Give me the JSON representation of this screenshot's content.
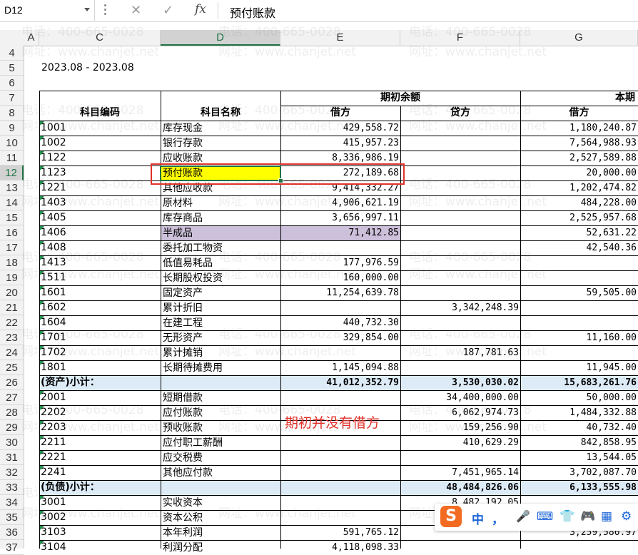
{
  "formula_bar": {
    "name_box": "D12",
    "formula": "预付账款",
    "fx_label": "fx",
    "cancel_glyph": "✕",
    "confirm_glyph": "✓"
  },
  "columns": [
    "A",
    "C",
    "D",
    "E",
    "F",
    "G"
  ],
  "selected_column": "D",
  "rows": [
    "4",
    "5",
    "6",
    "7",
    "8",
    "9",
    "10",
    "11",
    "12",
    "13",
    "14",
    "15",
    "16",
    "17",
    "18",
    "19",
    "20",
    "21",
    "22",
    "23",
    "24",
    "25",
    "26",
    "27",
    "28",
    "29",
    "30",
    "31",
    "32",
    "33",
    "34",
    "35",
    "36",
    "37"
  ],
  "selected_row": "12",
  "sheet": {
    "period": "2023.08 - 2023.08",
    "header_group_opening": "期初余额",
    "header_group_current": "本期",
    "header_code": "科目编码",
    "header_name": "科目名称",
    "header_debit": "借方",
    "header_credit": "贷方",
    "header_debit2": "借方",
    "data_rows": [
      {
        "code": "1001",
        "name": "库存现金",
        "debit": "429,558.72",
        "credit": "",
        "cur_debit": "1,180,240.87"
      },
      {
        "code": "1002",
        "name": "银行存款",
        "debit": "415,957.23",
        "credit": "",
        "cur_debit": "7,564,988.93"
      },
      {
        "code": "1122",
        "name": "应收账款",
        "debit": "8,336,986.19",
        "credit": "",
        "cur_debit": "2,527,589.88"
      },
      {
        "code": "1123",
        "name": "预付账款",
        "debit": "272,189.68",
        "credit": "",
        "cur_debit": "20,000.00"
      },
      {
        "code": "1221",
        "name": "其他应收款",
        "debit": "9,414,332.27",
        "credit": "",
        "cur_debit": "1,202,474.82"
      },
      {
        "code": "1403",
        "name": "原材料",
        "debit": "4,906,621.19",
        "credit": "",
        "cur_debit": "484,228.00"
      },
      {
        "code": "1405",
        "name": "库存商品",
        "debit": "3,656,997.11",
        "credit": "",
        "cur_debit": "2,525,957.68"
      },
      {
        "code": "1406",
        "name": "半成品",
        "debit": "71,412.85",
        "credit": "",
        "cur_debit": "52,631.22"
      },
      {
        "code": "1408",
        "name": "委托加工物资",
        "debit": "",
        "credit": "",
        "cur_debit": "42,540.36"
      },
      {
        "code": "1413",
        "name": "低值易耗品",
        "debit": "177,976.59",
        "credit": "",
        "cur_debit": ""
      },
      {
        "code": "1511",
        "name": "长期股权投资",
        "debit": "160,000.00",
        "credit": "",
        "cur_debit": ""
      },
      {
        "code": "1601",
        "name": "固定资产",
        "debit": "11,254,639.78",
        "credit": "",
        "cur_debit": "59,505.00"
      },
      {
        "code": "1602",
        "name": "累计折旧",
        "debit": "",
        "credit": "3,342,248.39",
        "cur_debit": ""
      },
      {
        "code": "1604",
        "name": "在建工程",
        "debit": "440,732.30",
        "credit": "",
        "cur_debit": ""
      },
      {
        "code": "1701",
        "name": "无形资产",
        "debit": "329,854.00",
        "credit": "",
        "cur_debit": "11,160.00"
      },
      {
        "code": "1702",
        "name": "累计摊销",
        "debit": "",
        "credit": "187,781.63",
        "cur_debit": ""
      },
      {
        "code": "1801",
        "name": "长期待摊费用",
        "debit": "1,145,094.88",
        "credit": "",
        "cur_debit": "11,945.00"
      },
      {
        "code": "(资产)小计：",
        "name": "",
        "debit": "41,012,352.79",
        "credit": "3,530,030.02",
        "cur_debit": "15,683,261.76"
      },
      {
        "code": "2001",
        "name": "短期借款",
        "debit": "",
        "credit": "34,400,000.00",
        "cur_debit": "50,000.00"
      },
      {
        "code": "2202",
        "name": "应付账款",
        "debit": "",
        "credit": "6,062,974.73",
        "cur_debit": "1,484,332.88"
      },
      {
        "code": "2203",
        "name": "预收账款",
        "debit": "",
        "credit": "159,256.90",
        "cur_debit": "40,732.40"
      },
      {
        "code": "2211",
        "name": "应付职工薪酬",
        "debit": "",
        "credit": "410,629.29",
        "cur_debit": "842,858.95"
      },
      {
        "code": "2221",
        "name": "应交税费",
        "debit": "",
        "credit": "",
        "cur_debit": "13,544.05"
      },
      {
        "code": "2241",
        "name": "其他应付款",
        "debit": "",
        "credit": "7,451,965.14",
        "cur_debit": "3,702,087.70"
      },
      {
        "code": "(负债)小计：",
        "name": "",
        "debit": "",
        "credit": "48,484,826.06",
        "cur_debit": "6,133,555.98"
      },
      {
        "code": "3001",
        "name": "实收资本",
        "debit": "",
        "credit": "8,482,192.05",
        "cur_debit": ""
      },
      {
        "code": "3002",
        "name": "资本公积",
        "debit": "",
        "credit": "",
        "cur_debit": ""
      },
      {
        "code": "3103",
        "name": "本年利润",
        "debit": "591,765.12",
        "credit": "",
        "cur_debit": "3,259,580.97"
      },
      {
        "code": "3104",
        "name": "利润分配",
        "debit": "4,118,098.33",
        "credit": "",
        "cur_debit": ""
      }
    ]
  },
  "annotation": "期初并没有借方",
  "watermark_phone": "电话：400-665-0028",
  "watermark_url": "网址：www.chanjet.net",
  "ime_toolbar": {
    "logo": "S",
    "lang": "中",
    "punct": "，",
    "icons": [
      "mic-icon",
      "keyboard-icon",
      "skin-icon",
      "gamepad-icon",
      "grid-icon",
      "settings-icon"
    ]
  },
  "colors": {
    "accent_green": "#217346",
    "highlight_yellow": "#ffff00",
    "highlight_purple": "#ccc0da",
    "subtotal_blue": "#ddebf7",
    "annotation_red": "#e0322b"
  }
}
